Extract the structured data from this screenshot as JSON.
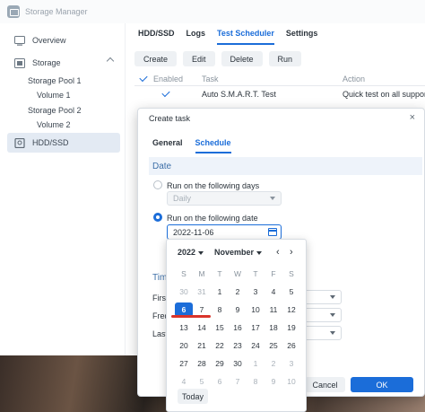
{
  "window": {
    "title": "Storage Manager"
  },
  "sidebar": {
    "items": [
      {
        "label": "Overview"
      },
      {
        "label": "Storage"
      },
      {
        "label": "Storage Pool 1"
      },
      {
        "label": "Volume 1"
      },
      {
        "label": "Storage Pool 2"
      },
      {
        "label": "Volume 2"
      },
      {
        "label": "HDD/SSD"
      }
    ]
  },
  "main": {
    "tabs": [
      "HDD/SSD",
      "Logs",
      "Test Scheduler",
      "Settings"
    ],
    "active_tab": "Test Scheduler",
    "toolbar": [
      "Create",
      "Edit",
      "Delete",
      "Run"
    ],
    "table": {
      "headers": [
        "Enabled",
        "Task",
        "Action"
      ],
      "rows": [
        {
          "task": "Auto S.M.A.R.T. Test",
          "action": "Quick test on all suppor"
        }
      ]
    }
  },
  "dialog": {
    "title": "Create task",
    "close": "×",
    "tabs": [
      "General",
      "Schedule"
    ],
    "section_date": "Date",
    "option_days": "Run on the following days",
    "days_value": "Daily",
    "option_date": "Run on the following date",
    "date_value": "2022-11-06",
    "section_time": "Tim",
    "labels": [
      "First",
      "Freq",
      "Last"
    ],
    "cancel": "Cancel",
    "ok": "OK"
  },
  "calendar": {
    "year": "2022",
    "month": "November",
    "prev": "‹",
    "next": "›",
    "weekdays": [
      "S",
      "M",
      "T",
      "W",
      "T",
      "F",
      "S"
    ],
    "weeks": [
      [
        "30",
        "31",
        "1",
        "2",
        "3",
        "4",
        "5"
      ],
      [
        "6",
        "7",
        "8",
        "9",
        "10",
        "11",
        "12"
      ],
      [
        "13",
        "14",
        "15",
        "16",
        "17",
        "18",
        "19"
      ],
      [
        "20",
        "21",
        "22",
        "23",
        "24",
        "25",
        "26"
      ],
      [
        "27",
        "28",
        "29",
        "30",
        "1",
        "2",
        "3"
      ],
      [
        "4",
        "5",
        "6",
        "7",
        "8",
        "9",
        "10"
      ]
    ],
    "selected": "6",
    "today": "Today"
  },
  "colors": {
    "accent": "#1b6dd9",
    "annotation": "#d9342b"
  }
}
